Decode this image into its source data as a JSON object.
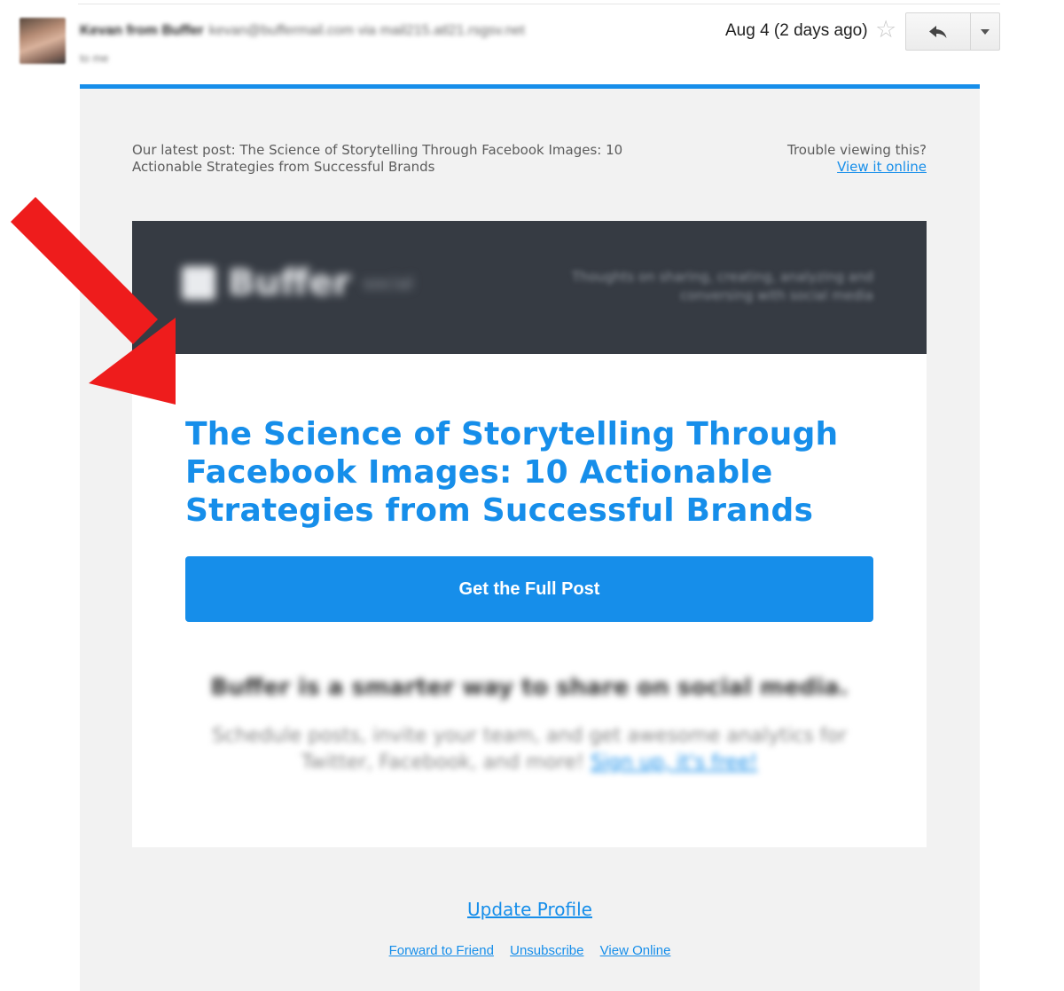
{
  "header": {
    "sender_name": "Kevan from Buffer",
    "sender_email": "kevan@buffermail.com via mail215.atl21.rsgsv.net",
    "to_line": "to me",
    "date": "Aug 4 (2 days ago)",
    "star_icon": "star-outline-icon",
    "reply_icon": "reply-arrow-icon",
    "more_icon": "chevron-down-icon"
  },
  "email": {
    "preheader": "Our latest post: The Science of Storytelling Through Facebook Images: 10 Actionable Strategies from Successful Brands",
    "trouble_text": "Trouble viewing this?",
    "view_online_link": "View it online",
    "banner": {
      "logo_text": "Buffer",
      "logo_sub": "social",
      "tagline": "Thoughts on sharing, creating, analyzing and conversing with social media"
    },
    "title": "The Science of Storytelling Through Facebook Images: 10 Actionable Strategies from Successful Brands",
    "cta_label": "Get the Full Post",
    "promo_heading": "Buffer is a smarter way to share on social media.",
    "promo_text": "Schedule posts, invite your team, and get awesome analytics for Twitter, Facebook, and more!",
    "promo_link": "Sign up, it's free!",
    "update_profile": "Update Profile",
    "footer": {
      "forward": "Forward to Friend",
      "unsubscribe": "Unsubscribe",
      "view_online": "View Online"
    }
  },
  "colors": {
    "accent": "#168eea",
    "banner": "#363b43",
    "annotation_arrow": "#ee1c1c"
  }
}
